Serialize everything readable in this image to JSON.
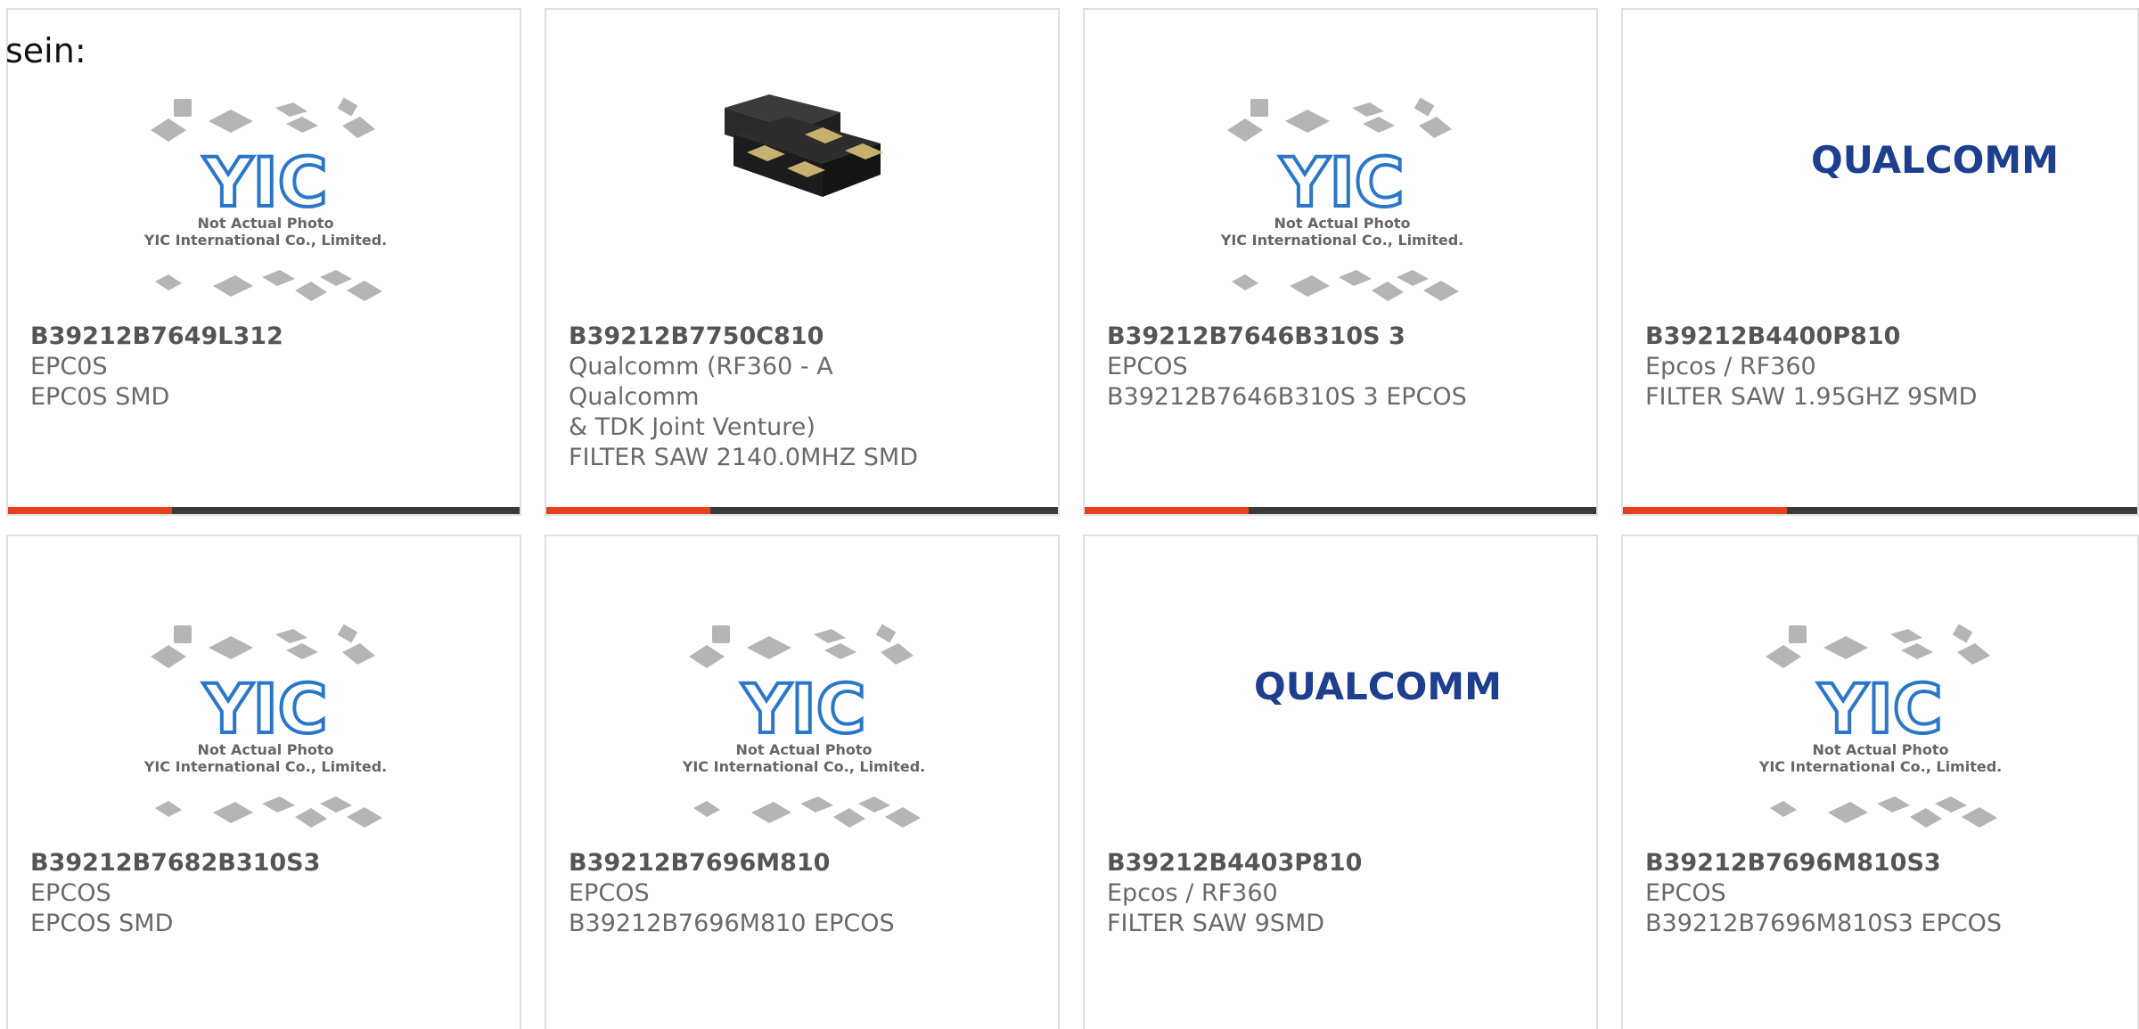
{
  "intro_text": "sein:",
  "colors": {
    "accent": "#e8401c",
    "bar_dark": "#3a3a3a",
    "yic_blue": "#2a77c9",
    "qualcomm_blue": "#1e3f8f",
    "text_gray": "#6a6a6a",
    "border": "#e0e0e0"
  },
  "placeholder": {
    "line1": "Not Actual Photo",
    "line2": "YIC International Co., Limited.",
    "logo": "YIC"
  },
  "products": [
    {
      "part_number": "B39212B7649L312",
      "manufacturer": "EPC0S",
      "desc_lines": [
        "EPC0S SMD"
      ],
      "image": "yic-placeholder"
    },
    {
      "part_number": "B39212B7750C810",
      "manufacturer": "Qualcomm (RF360 - A Qualcomm",
      "manufacturer_cont": "& TDK Joint Venture)",
      "desc_lines": [
        "FILTER SAW 2140.0MHZ SMD"
      ],
      "image": "smd-crystal-package"
    },
    {
      "part_number": "B39212B7646B310S 3",
      "manufacturer": "EPCOS",
      "desc_lines": [
        "B39212B7646B310S 3 EPCOS"
      ],
      "image": "yic-placeholder"
    },
    {
      "part_number": "B39212B4400P810",
      "manufacturer": "Epcos / RF360",
      "desc_lines": [
        "FILTER SAW 1.95GHZ 9SMD"
      ],
      "image": "qualcomm-logo",
      "logo_text": "QUALCOMM"
    },
    {
      "part_number": "B39212B7682B310S3",
      "manufacturer": "EPCOS",
      "desc_lines": [
        "EPCOS SMD"
      ],
      "image": "yic-placeholder"
    },
    {
      "part_number": "B39212B7696M810",
      "manufacturer": "EPCOS",
      "desc_lines": [
        "B39212B7696M810 EPCOS"
      ],
      "image": "yic-placeholder"
    },
    {
      "part_number": "B39212B4403P810",
      "manufacturer": "Epcos / RF360",
      "desc_lines": [
        "FILTER SAW 9SMD"
      ],
      "image": "qualcomm-logo",
      "logo_text": "QUALCOMM"
    },
    {
      "part_number": "B39212B7696M810S3",
      "manufacturer": "EPCOS",
      "desc_lines": [
        "B39212B7696M810S3 EPCOS"
      ],
      "image": "yic-placeholder"
    }
  ]
}
